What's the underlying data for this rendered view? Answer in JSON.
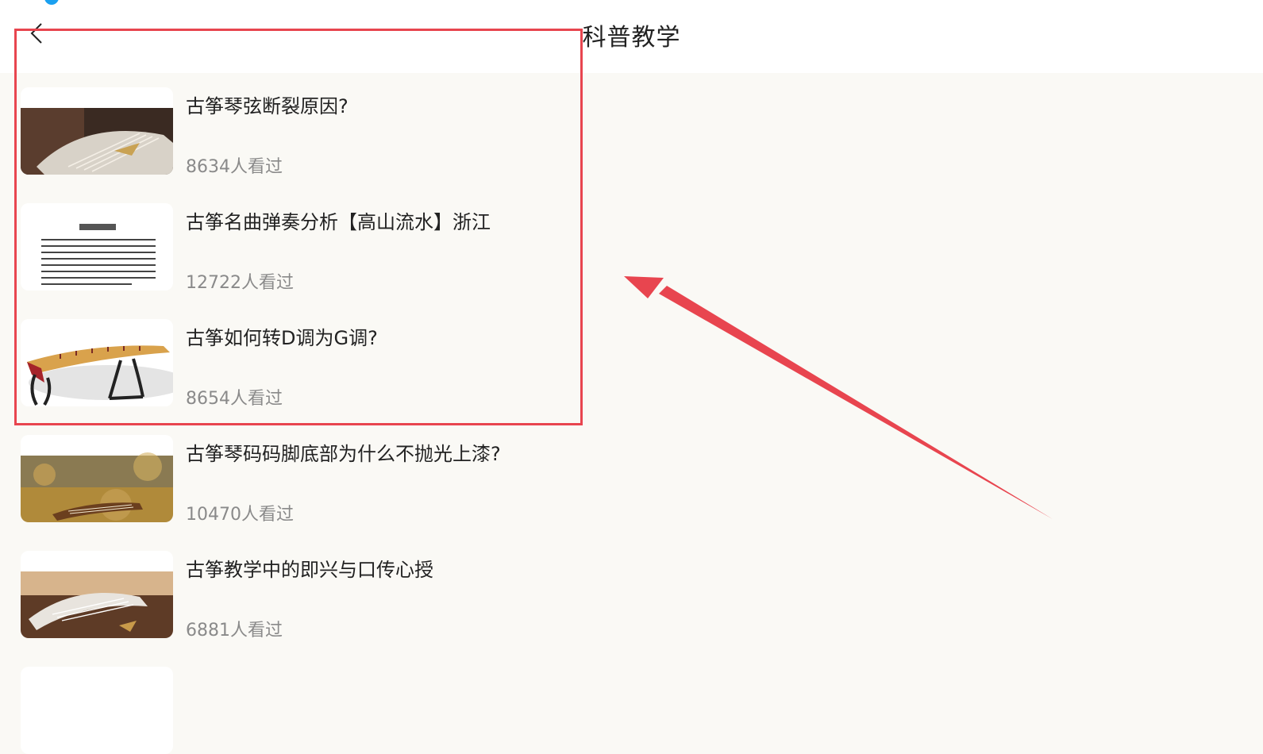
{
  "header": {
    "title": "科普教学",
    "back_icon": "chevron-left-icon"
  },
  "articles": [
    {
      "title": "古筝琴弦断裂原因?",
      "views": "8634人看过"
    },
    {
      "title": "古筝名曲弹奏分析【高山流水】浙江",
      "views": "12722人看过"
    },
    {
      "title": "古筝如何转D调为G调?",
      "views": "8654人看过"
    },
    {
      "title": "古筝琴码码脚底部为什么不抛光上漆?",
      "views": "10470人看过"
    },
    {
      "title": "古筝教学中的即兴与口传心授",
      "views": "6881人看过"
    }
  ],
  "colors": {
    "background": "#faf9f5",
    "header_bg": "#ffffff",
    "annotation": "#e8454f",
    "muted_text": "#8a8a8a"
  }
}
